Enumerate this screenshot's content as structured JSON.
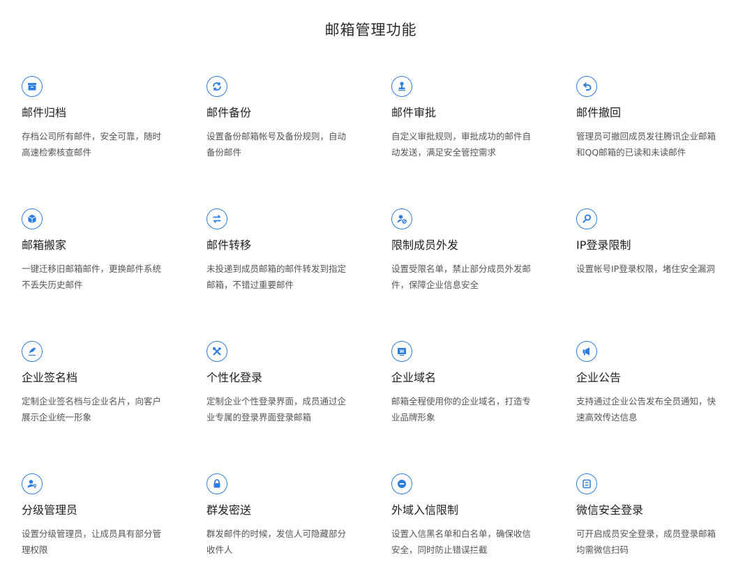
{
  "page": {
    "title": "邮箱管理功能"
  },
  "features": [
    {
      "icon": "archive-icon",
      "title": "邮件归档",
      "desc": "存档公司所有邮件，安全可靠，随时高速检索核查邮件"
    },
    {
      "icon": "refresh-backup-icon",
      "title": "邮件备份",
      "desc": "设置备份邮箱帐号及备份规则，自动备份邮件"
    },
    {
      "icon": "stamp-icon",
      "title": "邮件审批",
      "desc": "自定义审批规则，审批成功的邮件自动发送，满足安全管控需求"
    },
    {
      "icon": "undo-arrow-icon",
      "title": "邮件撤回",
      "desc": "管理员可撤回成员发往腾讯企业邮箱和QQ邮箱的已读和未读邮件"
    },
    {
      "icon": "box-icon",
      "title": "邮箱搬家",
      "desc": "一键迁移旧邮箱邮件，更换邮件系统不丢失历史邮件"
    },
    {
      "icon": "transfer-arrows-icon",
      "title": "邮件转移",
      "desc": "未投递到成员邮箱的邮件转发到指定邮箱，不错过重要邮件"
    },
    {
      "icon": "user-block-icon",
      "title": "限制成员外发",
      "desc": "设置受限名单，禁止部分成员外发邮件，保障企业信息安全"
    },
    {
      "icon": "key-icon",
      "title": "IP登录限制",
      "desc": "设置帐号IP登录权限，堵住安全漏洞"
    },
    {
      "icon": "feather-pen-icon",
      "title": "企业签名档",
      "desc": "定制企业签名档与企业名片，向客户展示企业统一形象"
    },
    {
      "icon": "tools-cross-icon",
      "title": "个性化登录",
      "desc": "定制企业个性登录界面，成员通过企业专属的登录界面登录邮箱"
    },
    {
      "icon": "web-domain-icon",
      "title": "企业域名",
      "desc": "邮箱全程使用你的企业域名，打造专业品牌形象"
    },
    {
      "icon": "megaphone-icon",
      "title": "企业公告",
      "desc": "支持通过企业公告发布全员通知，快速高效传达信息"
    },
    {
      "icon": "admin-user-icon",
      "title": "分级管理员",
      "desc": "设置分级管理员，让成员具有部分管理权限"
    },
    {
      "icon": "lock-icon",
      "title": "群发密送",
      "desc": "群发邮件的时候，发信人可隐藏部分收件人"
    },
    {
      "icon": "minus-circle-icon",
      "title": "外域入信限制",
      "desc": "设置入信黑名单和白名单，确保收信安全，同时防止错误拦截"
    },
    {
      "icon": "scan-icon",
      "title": "微信安全登录",
      "desc": "可开启成员安全登录，成员登录邮箱均需微信扫码"
    }
  ],
  "colors": {
    "accent": "#2e7de0",
    "title": "#1f1f1f",
    "desc": "#555555"
  }
}
